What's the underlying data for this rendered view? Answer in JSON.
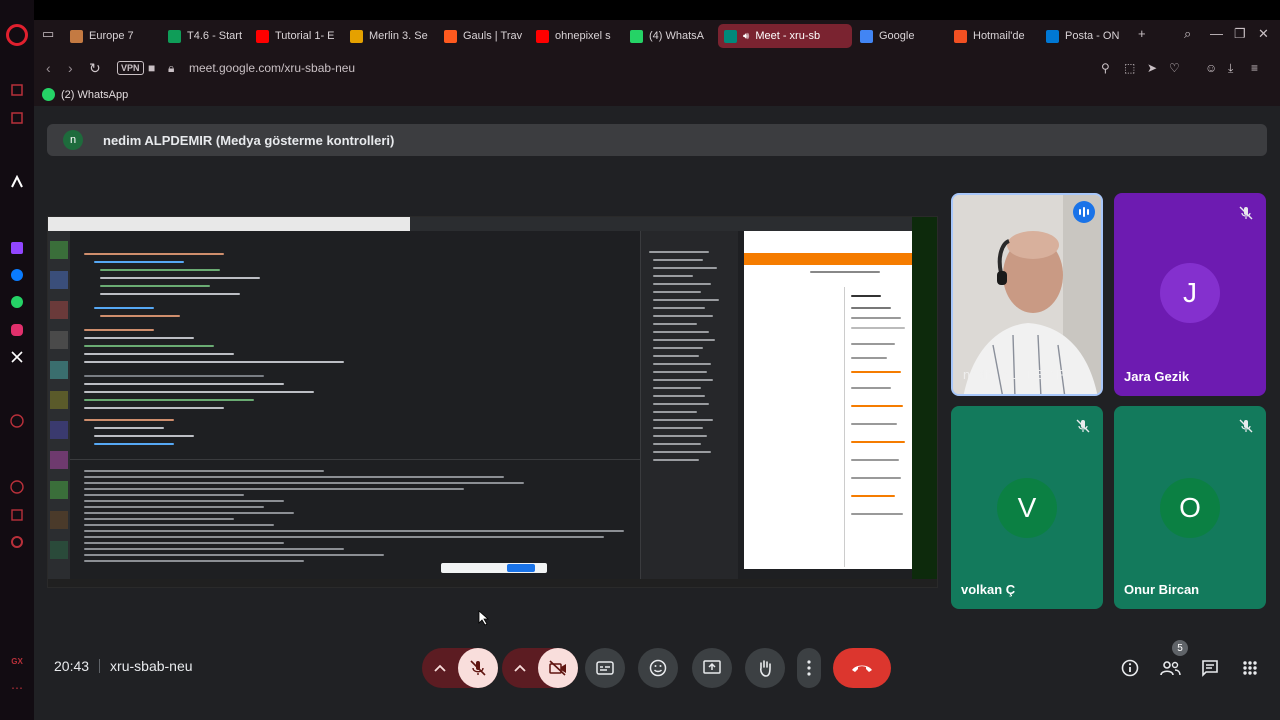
{
  "browser": {
    "tabs": [
      {
        "label": "Europe 7",
        "color": "#c47a42"
      },
      {
        "label": "T4.6 - Start",
        "color": "#0f9d58"
      },
      {
        "label": "Tutorial 1- E",
        "color": "#ff0000"
      },
      {
        "label": "Merlin 3. Se",
        "color": "#e5a100"
      },
      {
        "label": "Gauls | Trav",
        "color": "#ff5a1f"
      },
      {
        "label": "ohnepixel s",
        "color": "#ff0000"
      },
      {
        "label": "(4) WhatsA",
        "color": "#25d366"
      },
      {
        "label": "Meet - xru-sb",
        "color": "#00897b"
      },
      {
        "label": "Google",
        "color": "#4285f4"
      },
      {
        "label": "Hotmail'de",
        "color": "#f25022"
      },
      {
        "label": "Posta - ON",
        "color": "#0078d4"
      }
    ],
    "vpn_label": "VPN",
    "url": "meet.google.com/xru-sbab-neu",
    "bookmark": "(2) WhatsApp"
  },
  "meet": {
    "presenter_initial": "n",
    "presenter_banner": "nedim ALPDEMIR (Medya gösterme kontrolleri)",
    "participants": [
      {
        "name": "nedim ALPDEMIR",
        "initial": "",
        "speaking": true
      },
      {
        "name": "Jara Gezik",
        "initial": "J",
        "muted": true,
        "color": "#8430ce",
        "bg": "#6d1bb1"
      },
      {
        "name": "volkan Ç",
        "initial": "V",
        "muted": true,
        "color": "#0b8043",
        "bg": "#137a5c"
      },
      {
        "name": "Onur Bircan",
        "initial": "O",
        "muted": true,
        "color": "#0b8043",
        "bg": "#137a5c"
      }
    ],
    "time": "20:43",
    "meeting_code": "xru-sbab-neu",
    "participant_count": "5"
  }
}
